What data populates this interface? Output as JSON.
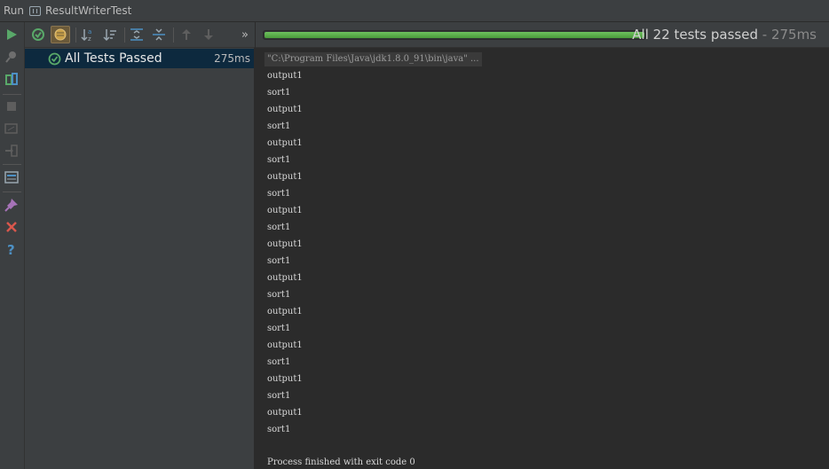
{
  "title_bar": {
    "run_label": "Run",
    "config_name": "ResultWriterTest"
  },
  "left_toolbar": {
    "icons": [
      "play-icon",
      "pin-icon",
      "rerun-failed-icon",
      "stop-icon",
      "restore-layout-icon",
      "exit-icon",
      "layout-icon",
      "pin-tab-icon",
      "close-icon",
      "help-icon"
    ]
  },
  "test_toolbar": {
    "icons": [
      "show-passed-icon",
      "show-ignored-icon",
      "sort-alpha-icon",
      "sort-duration-icon",
      "expand-all-icon",
      "collapse-all-icon",
      "prev-failed-icon",
      "next-failed-icon",
      "more-icon"
    ],
    "more_label": "»"
  },
  "tree": {
    "root_label": "All Tests Passed",
    "root_time": "275ms"
  },
  "status": {
    "text": "All 22 tests passed",
    "separator": " - ",
    "duration": "275ms",
    "progress": 1.0
  },
  "console": {
    "command": "\"C:\\Program Files\\Java\\jdk1.8.0_91\\bin\\java\" ...",
    "lines": [
      "output1",
      "sort1",
      "output1",
      "sort1",
      "output1",
      "sort1",
      "output1",
      "sort1",
      "output1",
      "sort1",
      "output1",
      "sort1",
      "output1",
      "sort1",
      "output1",
      "sort1",
      "output1",
      "sort1",
      "output1",
      "sort1",
      "output1",
      "sort1"
    ],
    "finish": "Process finished with exit code 0"
  },
  "colors": {
    "success": "#4a9a3a",
    "selection": "#0d293e",
    "panel": "#3c3f41",
    "console_bg": "#2b2b2b"
  }
}
